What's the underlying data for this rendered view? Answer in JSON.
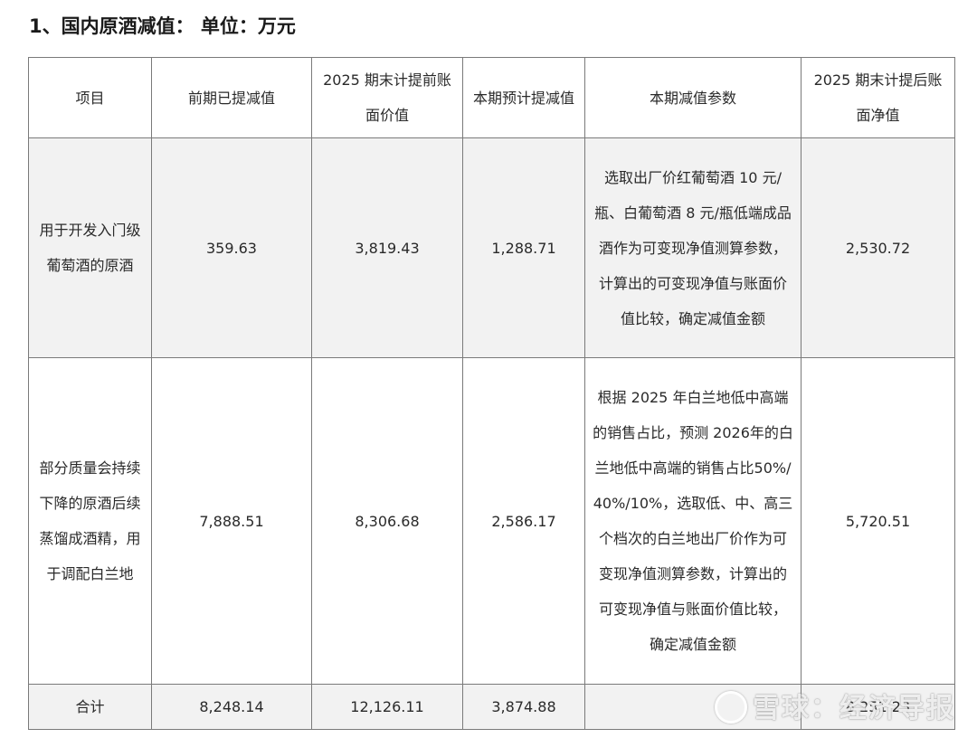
{
  "heading": "1、国内原酒减值： 单位：万元",
  "table": {
    "headers": [
      "项目",
      "前期已提减值",
      "2025 期末计提前账面价值",
      "本期预计提减值",
      "本期减值参数",
      "2025 期末计提后账面净值"
    ],
    "rows": [
      {
        "item": "用于开发入门级葡萄酒的原酒",
        "prior_impairment": "359.63",
        "book_value_before": "3,819.43",
        "current_impairment": "1,288.71",
        "parameters": "选取出厂价红葡萄酒 10 元/瓶、白葡萄酒 8 元/瓶低端成品酒作为可变现净值测算参数，计算出的可变现净值与账面价值比较，确定减值金额",
        "net_value_after": "2,530.72"
      },
      {
        "item": "部分质量会持续下降的原酒后续蒸馏成酒精，用于调配白兰地",
        "prior_impairment": "7,888.51",
        "book_value_before": "8,306.68",
        "current_impairment": "2,586.17",
        "parameters": "根据 2025 年白兰地低中高端的销售占比，预测 2026年的白兰地低中高端的销售占比50%/40%/10%，选取低、中、高三个档次的白兰地出厂价作为可变现净值测算参数，计算出的可变现净值与账面价值比较，确定减值金额",
        "net_value_after": "5,720.51"
      }
    ],
    "total": {
      "label": "合计",
      "prior_impairment": "8,248.14",
      "book_value_before": "12,126.11",
      "current_impairment": "3,874.88",
      "parameters": "",
      "net_value_after": "8,251.23"
    }
  },
  "watermark": "雪球：经济导报"
}
